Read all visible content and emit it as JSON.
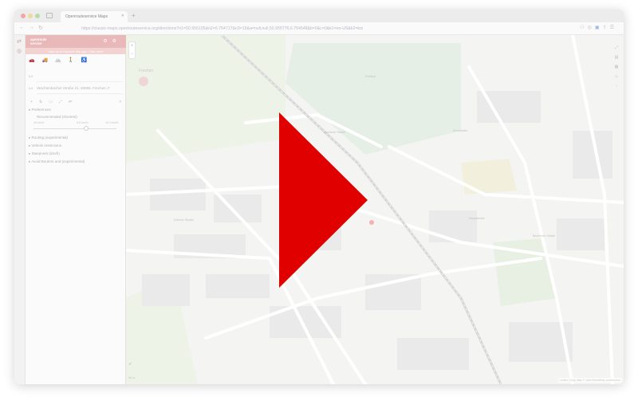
{
  "browser": {
    "tab_title": "Openrouteservice Maps",
    "url": "https://classic-maps.openrouteservice.org/directions?n1=50.955105&n2=6.754717&n3=15&a=null,null,50.955776,6.754548&b=0&c=0&k1=en-US&k2=km"
  },
  "app": {
    "brand_line1": "openroute",
    "brand_line2": "service",
    "notice": "Help us to improve this app. Click here!",
    "route": {
      "start_label": "Lo",
      "start_value": "",
      "end_label": "Lo",
      "end_value": "Wachtenbacher Straße 21, 50858, Frechen, F"
    },
    "sections": {
      "avoid": "Preferences",
      "preference": "Recommended (shortest)",
      "avoid_ferries": "Routing (experimental)",
      "restrictions": "Vehicle restrictions",
      "steepness": "Steepness (km/h)",
      "extra": "Avoid Borders and (experimental)"
    },
    "slider": {
      "min_label": "10 km/h",
      "mid_label": "5.0 km/h",
      "max_label": "12.0 km/h",
      "fraction": 0.63
    }
  },
  "map": {
    "place_labels": [
      "Frechen",
      "Aachener Straße",
      "Kirchstraße",
      "Hauptstraße",
      "Dürener Straße",
      "Bachemer Straße",
      "Friedhof"
    ],
    "attribution": "Leaflet | Map data © OpenStreetMap contributors"
  },
  "overlay": {
    "play_color": "#e00000"
  }
}
